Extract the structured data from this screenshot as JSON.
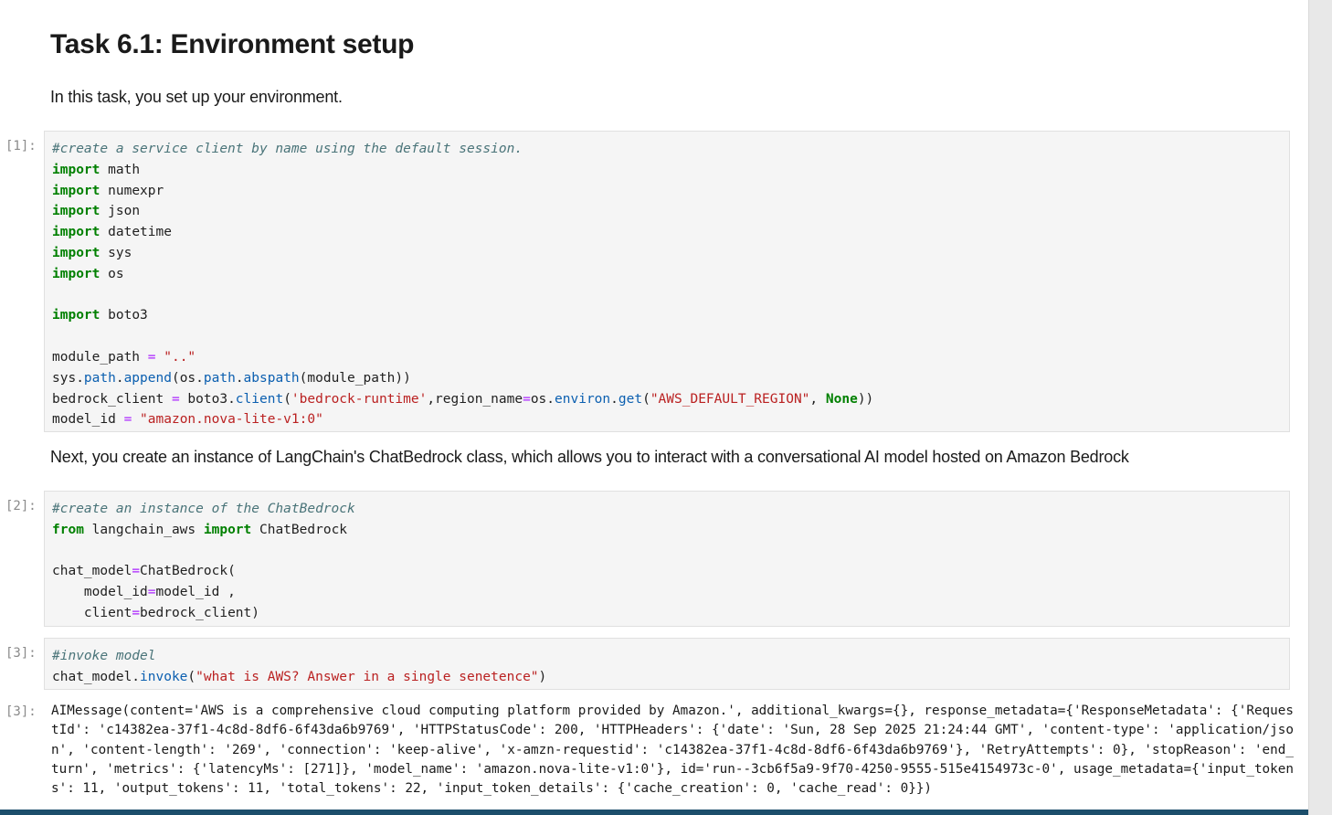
{
  "heading": "Task 6.1: Environment setup",
  "intro_text": "In this task, you set up your environment.",
  "mid_text": "Next, you create an instance of LangChain's ChatBedrock class, which allows you to interact with a conversational AI model hosted on Amazon Bedrock",
  "cells": [
    {
      "prompt": "[1]:",
      "comment": "#create a service client by name using the default session.",
      "imports": [
        "math",
        "numexpr",
        "json",
        "datetime",
        "sys",
        "os"
      ],
      "import_boto": "boto3",
      "keyword_import": "import",
      "module_path_var": "module_path",
      "module_path_value": "\"..\"",
      "sys_prefix": "sys.",
      "path_attr": "path",
      "append_attr": "append",
      "os_prefix": "(os.",
      "abspath_attr": "abspath",
      "sys_suffix": "(module_path))",
      "client_var": "bedrock_client ",
      "client_call_prefix": " boto3.",
      "client_attr": "client",
      "service_name": "'bedrock-runtime'",
      "region_kw": ",region_name",
      "os_environ_prefix": "os.",
      "environ_attr": "environ",
      "get_attr": "get",
      "region_env": "\"AWS_DEFAULT_REGION\"",
      "none_kw": "None",
      "model_id_var": "model_id ",
      "model_id_value": "\"amazon.nova-lite-v1:0\""
    },
    {
      "prompt": "[2]:",
      "comment": "#create an instance of the ChatBedrock",
      "from_kw": "from",
      "module": " langchain_aws ",
      "import_kw": "import",
      "class_name": " ChatBedrock",
      "line_chat": "chat_model",
      "ctor": "ChatBedrock(",
      "arg1_name": "    model_id",
      "arg1_value": "model_id ,",
      "arg2_name": "    client",
      "arg2_value": "bedrock_client)"
    },
    {
      "prompt": "[3]:",
      "comment": "#invoke model",
      "call_prefix": "chat_model.",
      "invoke_attr": "invoke",
      "question": "\"what is AWS? Answer in a single senetence\"",
      "output_prompt": "[3]:",
      "output": "AIMessage(content='AWS is a comprehensive cloud computing platform provided by Amazon.', additional_kwargs={}, response_metadata={'ResponseMetadata': {'RequestId': 'c14382ea-37f1-4c8d-8df6-6f43da6b9769', 'HTTPStatusCode': 200, 'HTTPHeaders': {'date': 'Sun, 28 Sep 2025 21:24:44 GMT', 'content-type': 'application/json', 'content-length': '269', 'connection': 'keep-alive', 'x-amzn-requestid': 'c14382ea-37f1-4c8d-8df6-6f43da6b9769'}, 'RetryAttempts': 0}, 'stopReason': 'end_turn', 'metrics': {'latencyMs': [271]}, 'model_name': 'amazon.nova-lite-v1:0'}, id='run--3cb6f5a9-9f70-4250-9555-515e4154973c-0', usage_metadata={'input_tokens': 11, 'output_tokens': 11, 'total_tokens': 22, 'input_token_details': {'cache_creation': 0, 'cache_read': 0}})"
    }
  ],
  "colors": {
    "cell_bg": "#f5f5f5",
    "keyword": "#008000",
    "string": "#ba2121",
    "comment": "#4a7479",
    "attribute": "#0b5fb0",
    "operator": "#aa22ff",
    "bottom_bar": "#1c4e6b"
  }
}
